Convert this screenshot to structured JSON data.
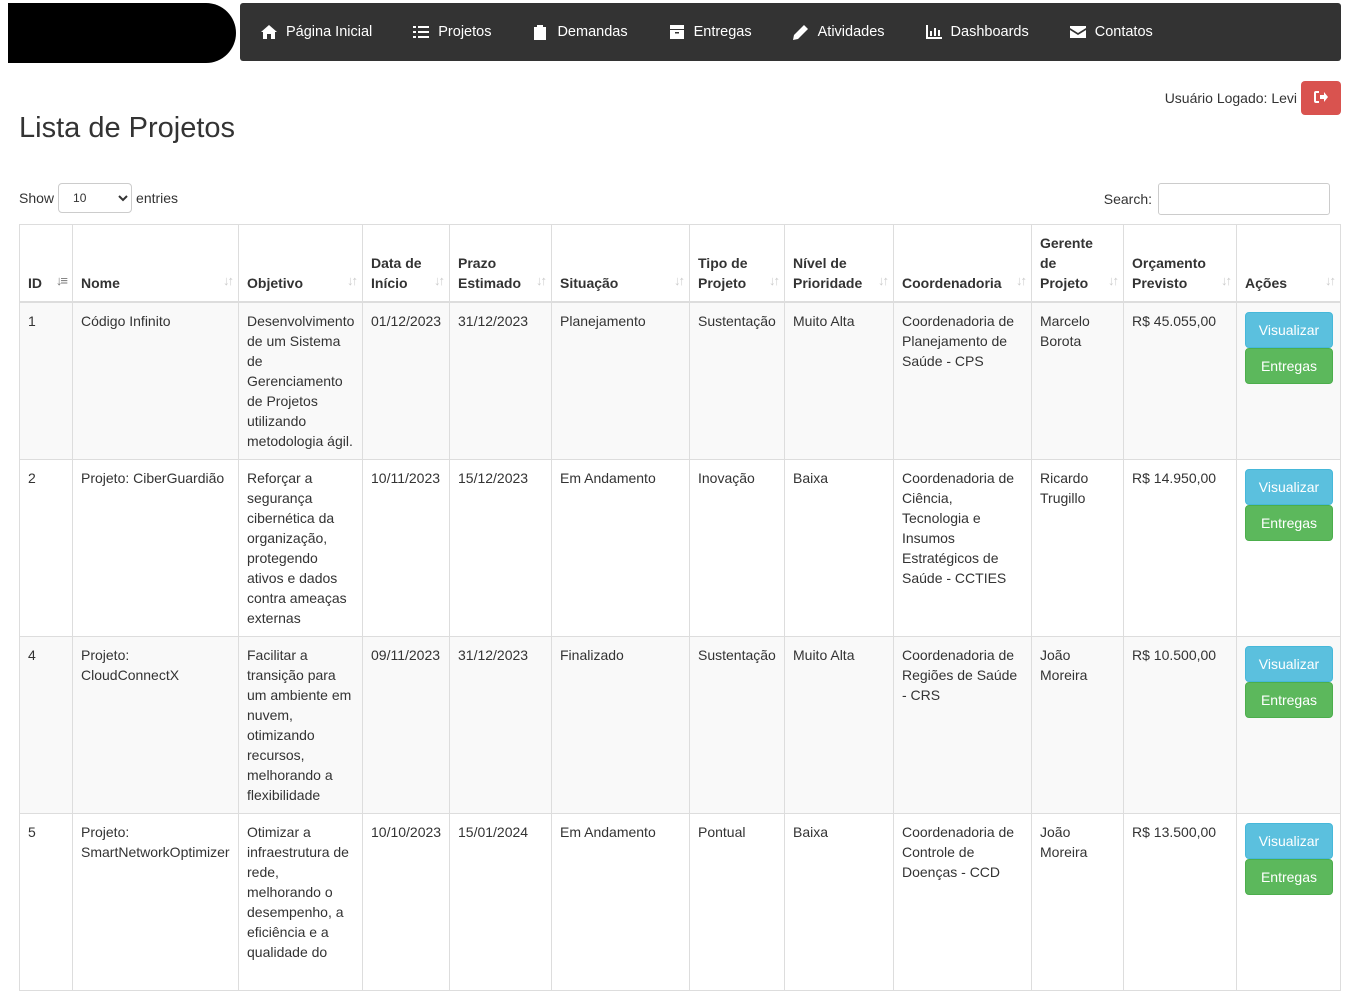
{
  "nav": [
    {
      "label": "Página Inicial",
      "icon": "home-icon"
    },
    {
      "label": "Projetos",
      "icon": "list-icon"
    },
    {
      "label": "Demandas",
      "icon": "clipboard-icon"
    },
    {
      "label": "Entregas",
      "icon": "archive-icon"
    },
    {
      "label": "Atividades",
      "icon": "pencil-icon"
    },
    {
      "label": "Dashboards",
      "icon": "bar-chart-icon"
    },
    {
      "label": "Contatos",
      "icon": "envelope-icon"
    }
  ],
  "user": {
    "label": "Usuário Logado: Levi"
  },
  "page": {
    "title": "Lista de Projetos"
  },
  "length": {
    "show": "Show",
    "value": "10",
    "entries": "entries"
  },
  "search": {
    "label": "Search:"
  },
  "table": {
    "headers": [
      "ID",
      "Nome",
      "Objetivo",
      "Data de Início",
      "Prazo Estimado",
      "Situação",
      "Tipo de Projeto",
      "Nível de Prioridade",
      "Coordenadoria",
      "Gerente de Projeto",
      "Orçamento Previsto",
      "Ações"
    ],
    "rows": [
      {
        "id": "1",
        "nome": "Código Infinito",
        "objetivo": "Desenvolvimento de um Sistema de Gerenciamento de Projetos utilizando metodologia ágil.",
        "inicio": "01/12/2023",
        "prazo": "31/12/2023",
        "situacao": "Planejamento",
        "tipo": "Sustentação",
        "prioridade": "Muito Alta",
        "coordenadoria": "Coordenadoria de Planejamento de Saúde - CPS",
        "gerente": "Marcelo Borota",
        "orcamento": "R$ 45.055,00"
      },
      {
        "id": "2",
        "nome": "Projeto: CiberGuardião",
        "objetivo": "Reforçar a segurança cibernética da organização, protegendo ativos e dados contra ameaças externas",
        "inicio": "10/11/2023",
        "prazo": "15/12/2023",
        "situacao": "Em Andamento",
        "tipo": "Inovação",
        "prioridade": "Baixa",
        "coordenadoria": "Coordenadoria de Ciência, Tecnologia e Insumos Estratégicos de Saúde - CCTIES",
        "gerente": "Ricardo Trugillo",
        "orcamento": "R$ 14.950,00"
      },
      {
        "id": "4",
        "nome": "Projeto: CloudConnectX",
        "objetivo": "Facilitar a transição para um ambiente em nuvem, otimizando recursos, melhorando a flexibilidade",
        "inicio": "09/11/2023",
        "prazo": "31/12/2023",
        "situacao": "Finalizado",
        "tipo": "Sustentação",
        "prioridade": "Muito Alta",
        "coordenadoria": "Coordenadoria de Regiões de Saúde - CRS",
        "gerente": "João Moreira",
        "orcamento": "R$ 10.500,00"
      },
      {
        "id": "5",
        "nome": "Projeto: SmartNetworkOptimizer",
        "objetivo": "Otimizar a infraestrutura de rede, melhorando o desempenho, a eficiência e a qualidade do",
        "inicio": "10/10/2023",
        "prazo": "15/01/2024",
        "situacao": "Em Andamento",
        "tipo": "Pontual",
        "prioridade": "Baixa",
        "coordenadoria": "Coordenadoria de Controle de Doenças - CCD",
        "gerente": "João Moreira",
        "orcamento": "R$ 13.500,00"
      }
    ],
    "actions": {
      "view": "Visualizar",
      "deliveries": "Entregas"
    }
  },
  "colors": {
    "navbar": "#333333",
    "logout": "#d9534f",
    "info": "#5bc0de",
    "success": "#5cb85c",
    "stripe": "#f9f9f9"
  }
}
